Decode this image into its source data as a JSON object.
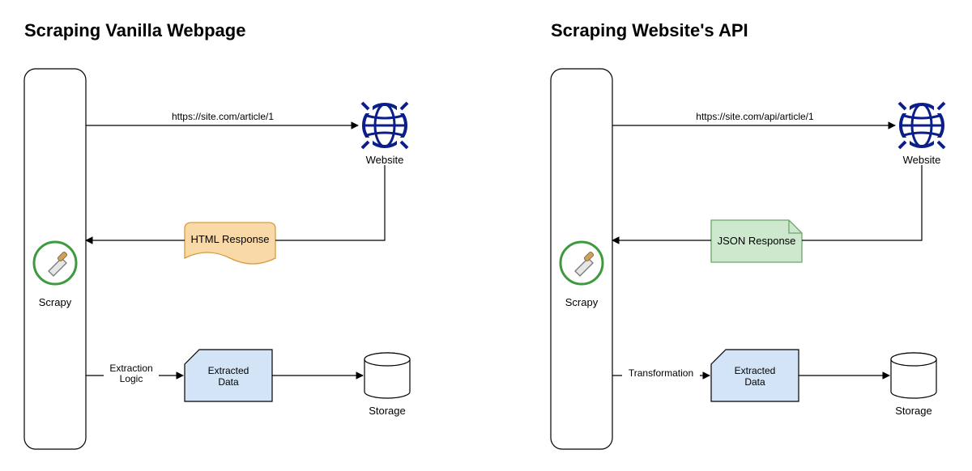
{
  "left": {
    "title": "Scraping Vanilla Webpage",
    "scrapy_label": "Scrapy",
    "request_url": "https://site.com/article/1",
    "website_label": "Website",
    "response_label": "HTML Response",
    "edge_label_line1": "Extraction",
    "edge_label_line2": "Logic",
    "data_label_line1": "Extracted",
    "data_label_line2": "Data",
    "storage_label": "Storage"
  },
  "right": {
    "title": "Scraping Website's API",
    "scrapy_label": "Scrapy",
    "request_url": "https://site.com/api/article/1",
    "website_label": "Website",
    "response_label": "JSON Response",
    "edge_label_line1": "Transformation",
    "data_label_line1": "Extracted",
    "data_label_line2": "Data",
    "storage_label": "Storage"
  },
  "colors": {
    "globe": "#0b1e8a",
    "scrapy_ring": "#3d9a3d",
    "html_fill": "#f9d9a8",
    "html_stroke": "#d99b3f",
    "json_fill": "#cde8cc",
    "json_stroke": "#6fa36f",
    "data_fill": "#d2e4f5",
    "data_stroke": "#000000"
  }
}
